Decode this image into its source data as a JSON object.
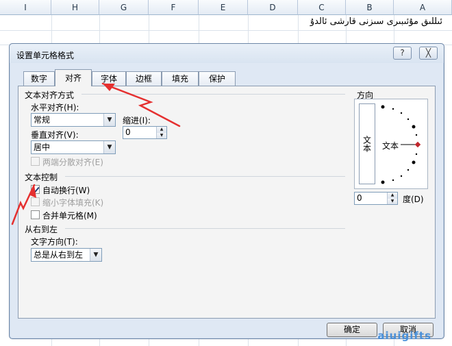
{
  "spreadsheet": {
    "columns": [
      "I",
      "H",
      "G",
      "F",
      "E",
      "D",
      "C",
      "B",
      "A"
    ],
    "cell_a1": "ئىللىق مۇئىبىرى سىزنى قارشى ئالدۇ"
  },
  "dialog": {
    "title": "设置单元格格式",
    "help_label": "?",
    "close_label": "╳",
    "tabs": [
      "数字",
      "对齐",
      "字体",
      "边框",
      "填充",
      "保护"
    ],
    "active_tab": "对齐",
    "text_alignment": {
      "group_label": "文本对齐方式",
      "horizontal_label": "水平对齐(H):",
      "horizontal_value": "常规",
      "indent_label": "缩进(I):",
      "indent_value": "0",
      "vertical_label": "垂直对齐(V):",
      "vertical_value": "居中",
      "justify_distributed_label": "两端分散对齐(E)"
    },
    "text_control": {
      "group_label": "文本控制",
      "wrap_text_label": "自动换行(W)",
      "wrap_text_checked": true,
      "shrink_to_fit_label": "缩小字体填充(K)",
      "shrink_to_fit_checked": false,
      "merge_cells_label": "合并单元格(M)",
      "merge_cells_checked": false
    },
    "rtl": {
      "group_label": "从右到左",
      "direction_label": "文字方向(T):",
      "direction_value": "总是从右到左"
    },
    "orientation": {
      "group_label": "方向",
      "vertical_text": "文本",
      "dial_text": "文本",
      "degrees_value": "0",
      "degrees_label": "度(D)"
    },
    "ok_label": "确定",
    "cancel_label": "取消"
  },
  "watermark": "aiuigifts",
  "colors": {
    "annotation_arrow": "#e53030",
    "dialog_bg": "#dfe8f4",
    "panel_bg": "#f4f4f4",
    "dial_marker": "#c0272d"
  }
}
